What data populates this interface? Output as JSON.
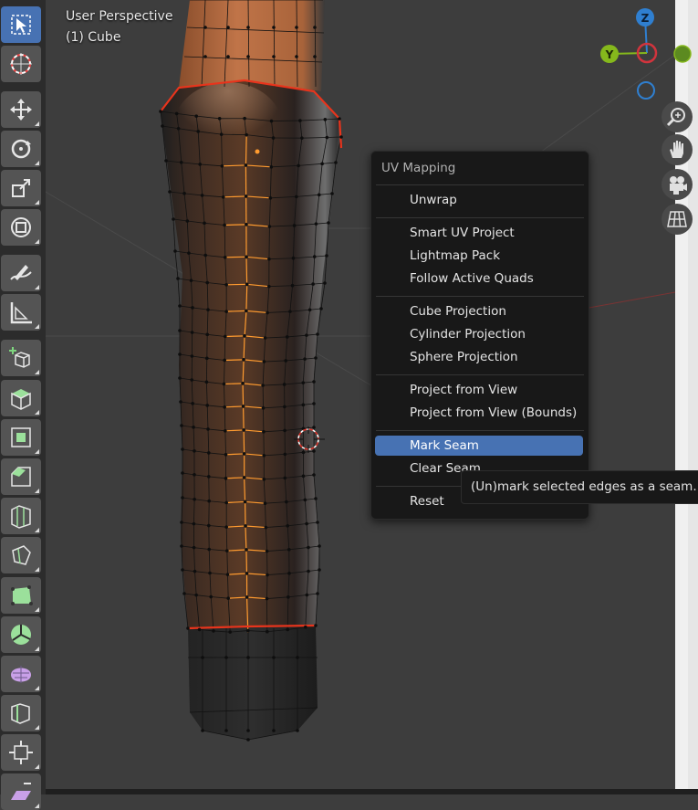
{
  "viewport": {
    "perspective_label": "User Perspective",
    "object_label": "(1) Cube"
  },
  "gizmo": {
    "z_label": "Z",
    "y_label": "Y",
    "colors": {
      "x": "#d1343d",
      "y": "#85b81c",
      "z": "#2f7fd0",
      "neg": "#385a8a"
    }
  },
  "toolbar": {
    "tools": [
      {
        "name": "select-box-tool",
        "icon": "cursor-box-icon",
        "active": true
      },
      {
        "name": "cursor-tool",
        "icon": "3d-cursor-icon"
      },
      {
        "name": "move-tool",
        "icon": "move-arrows-icon"
      },
      {
        "name": "rotate-tool",
        "icon": "rotate-icon"
      },
      {
        "name": "scale-tool",
        "icon": "scale-icon"
      },
      {
        "name": "transform-tool",
        "icon": "transform-icon"
      },
      {
        "name": "annotate-tool",
        "icon": "annotate-pen-icon"
      },
      {
        "name": "measure-tool",
        "icon": "ruler-icon"
      },
      {
        "name": "add-cube-tool",
        "icon": "add-cube-icon"
      },
      {
        "name": "extrude-tool",
        "icon": "extrude-icon"
      },
      {
        "name": "inset-tool",
        "icon": "inset-icon"
      },
      {
        "name": "bevel-tool",
        "icon": "bevel-icon"
      },
      {
        "name": "loop-cut-tool",
        "icon": "loop-cut-icon"
      },
      {
        "name": "knife-tool",
        "icon": "knife-icon"
      },
      {
        "name": "poly-build-tool",
        "icon": "poly-build-icon"
      },
      {
        "name": "spin-tool",
        "icon": "spin-icon"
      },
      {
        "name": "smooth-tool",
        "icon": "smooth-icon"
      },
      {
        "name": "edge-slide-tool",
        "icon": "edge-slide-icon"
      },
      {
        "name": "shrink-fatten-tool",
        "icon": "shrink-fatten-icon"
      },
      {
        "name": "shear-tool",
        "icon": "shear-icon"
      }
    ]
  },
  "nav_buttons": [
    {
      "name": "zoom-button",
      "icon": "zoom-icon"
    },
    {
      "name": "pan-button",
      "icon": "hand-icon"
    },
    {
      "name": "camera-button",
      "icon": "camera-icon"
    },
    {
      "name": "ortho-toggle-button",
      "icon": "grid-icon"
    }
  ],
  "menu": {
    "title": "UV Mapping",
    "items": {
      "unwrap": "Unwrap",
      "smart_uv": "Smart UV Project",
      "lightmap": "Lightmap Pack",
      "follow_quads": "Follow Active Quads",
      "cube_proj": "Cube Projection",
      "cylinder_proj": "Cylinder Projection",
      "sphere_proj": "Sphere Projection",
      "project_view": "Project from View",
      "project_view_bounds": "Project from View (Bounds)",
      "mark_seam": "Mark Seam",
      "clear_seam": "Clear Seam",
      "reset": "Reset"
    }
  },
  "tooltip": {
    "text": "(Un)mark selected edges as a seam."
  },
  "colors": {
    "selection": "#ff9b2f",
    "seam": "#e8341c",
    "menu_highlight": "#4772b3"
  }
}
